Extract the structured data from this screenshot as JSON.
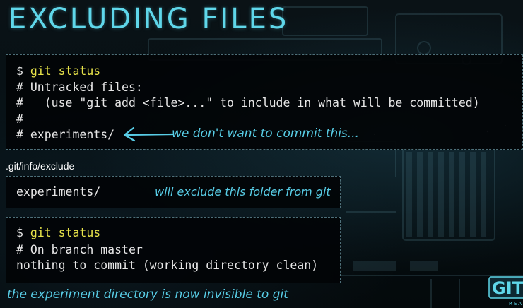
{
  "title": "EXCLUDING FILES",
  "panel1": {
    "prompt": "$ ",
    "command": "git status",
    "lines": [
      "# Untracked files:",
      "#   (use \"git add <file>...\" to include in what will be committed)",
      "#",
      "# experiments/"
    ],
    "annotation": "we don't want to commit this..."
  },
  "exclude_path": ".git/info/exclude",
  "panel2": {
    "entry": "experiments/",
    "annotation": "will exclude this folder from git"
  },
  "panel3": {
    "prompt": "$ ",
    "command": "git status",
    "lines": [
      "# On branch master",
      "nothing to commit (working directory clean)"
    ]
  },
  "footer_note": "the experiment directory is now invisible to git",
  "logo": {
    "text": "GIT",
    "subtext": "REA"
  },
  "colors": {
    "accent": "#5fd7ea",
    "command": "#e7e34a",
    "handwriting": "#58cde6",
    "code_text": "#e6e6e6"
  }
}
